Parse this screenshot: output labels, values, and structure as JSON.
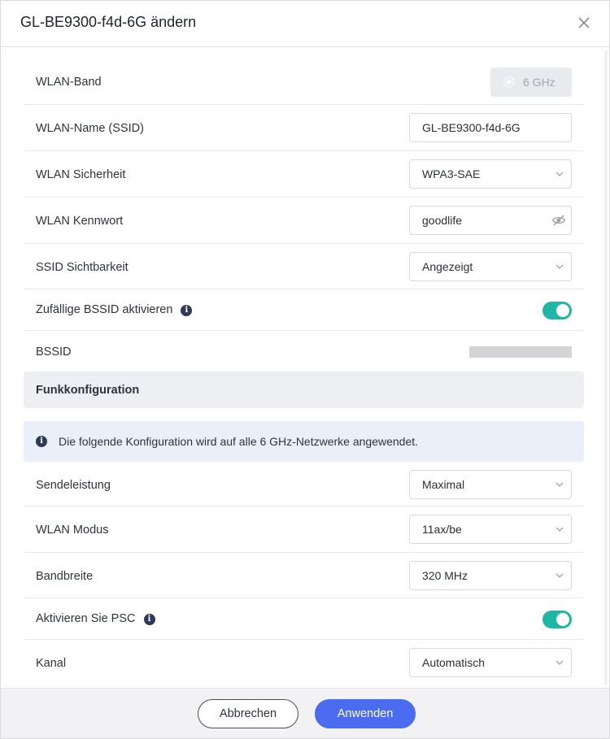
{
  "dialog": {
    "title": "GL-BE9300-f4d-6G ändern"
  },
  "rows": {
    "band": {
      "label": "WLAN-Band",
      "value": "6 GHz"
    },
    "ssid": {
      "label": "WLAN-Name (SSID)",
      "value": "GL-BE9300-f4d-6G"
    },
    "security": {
      "label": "WLAN Sicherheit",
      "value": "WPA3-SAE"
    },
    "password": {
      "label": "WLAN Kennwort",
      "value": "goodlife"
    },
    "visibility": {
      "label": "SSID Sichtbarkeit",
      "value": "Angezeigt"
    },
    "random_bssid": {
      "label": "Zufällige BSSID aktivieren",
      "enabled": true
    },
    "bssid": {
      "label": "BSSID"
    },
    "tx_power": {
      "label": "Sendeleistung",
      "value": "Maximal"
    },
    "mode": {
      "label": "WLAN Modus",
      "value": "11ax/be"
    },
    "bandwidth": {
      "label": "Bandbreite",
      "value": "320 MHz"
    },
    "psc": {
      "label": "Aktivieren Sie PSC",
      "enabled": true
    },
    "channel": {
      "label": "Kanal",
      "value": "Automatisch"
    }
  },
  "section": {
    "title": "Funkkonfiguration",
    "notice": "Die folgende Konfiguration wird auf alle 6 GHz-Netzwerke angewendet."
  },
  "footer": {
    "cancel_label": "Abbrechen",
    "apply_label": "Anwenden"
  },
  "colors": {
    "accent": "#4b6cf0",
    "toggle_on": "#1fb6a5",
    "info_icon": "#2e3a57"
  },
  "icons": {
    "close": "close-icon",
    "info": "info-icon",
    "chevron": "chevron-down-icon",
    "eye_hidden": "eye-off-icon"
  }
}
